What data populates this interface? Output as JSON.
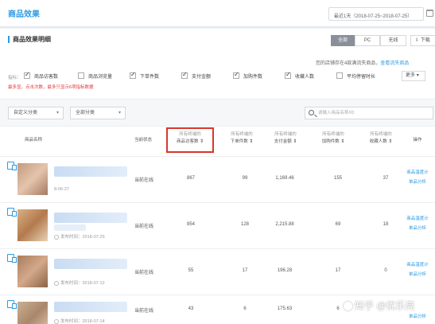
{
  "page": {
    "title": "商品效果"
  },
  "date_range": {
    "label": "最近1天（2018-07-25~2018-07-25）"
  },
  "section": {
    "title": "商品效果明细",
    "segments": [
      "全部",
      "PC",
      "无线"
    ],
    "active_segment": "全部",
    "download_label": "下载"
  },
  "limit_note": {
    "text": "您的店铺存在4款满流失商品，",
    "link": "查看流失商品"
  },
  "metrics": {
    "prefix": "指标：",
    "items": [
      {
        "label": "商品访客数",
        "checked": true
      },
      {
        "label": "商品浏览量",
        "checked": false
      },
      {
        "label": "下单件数",
        "checked": true
      },
      {
        "label": "支付金额",
        "checked": true
      },
      {
        "label": "加购件数",
        "checked": true
      },
      {
        "label": "收藏人数",
        "checked": true
      },
      {
        "label": "平均停留时长",
        "checked": false
      }
    ],
    "more_label": "更多",
    "warning": "最多显，点击次数，最多只显示6项指标数据"
  },
  "filters": {
    "category_1": "自定义分类",
    "category_2": "全部分类",
    "search_placeholder": "请输入商品名称/ID"
  },
  "table": {
    "columns": [
      {
        "sub": "",
        "label": "商品名称"
      },
      {
        "sub": "",
        "label": "当前状态"
      },
      {
        "sub": "所有终端的",
        "label": "商品访客数"
      },
      {
        "sub": "所有终端的",
        "label": "下单件数"
      },
      {
        "sub": "所有终端的",
        "label": "支付金额"
      },
      {
        "sub": "所有终端的",
        "label": "加购件数"
      },
      {
        "sub": "所有终端的",
        "label": "收藏人数"
      },
      {
        "sub": "",
        "label": "操作"
      }
    ],
    "rows": [
      {
        "publish": "8-06-27",
        "status": "当前在线",
        "visitors": "867",
        "orders": "99",
        "payment": "1,169.46",
        "cart": "155",
        "favorites": "37",
        "actions": [
          "商品温度计",
          "单品分析"
        ]
      },
      {
        "publish": "发布时间：2018-07-25",
        "status": "当前在线",
        "visitors": "854",
        "orders": "128",
        "payment": "2,215.88",
        "cart": "69",
        "favorites": "18",
        "actions": [
          "商品温度计",
          "单品分析"
        ]
      },
      {
        "publish": "发布时间：2018-07-12",
        "status": "当前在线",
        "visitors": "55",
        "orders": "17",
        "payment": "196.28",
        "cart": "17",
        "favorites": "0",
        "actions": [
          "商品温度计",
          "单品分析"
        ]
      },
      {
        "publish": "发布时间：2018-07-14",
        "status": "当前在线",
        "visitors": "43",
        "orders": "6",
        "payment": "175.63",
        "cart": "6",
        "favorites": "",
        "actions": [
          "商品温度计",
          "单品分析"
        ]
      }
    ]
  },
  "watermark": {
    "text": "知乎 @优乐亮"
  },
  "colors": {
    "accent": "#2e9be0",
    "highlight": "#d9362b",
    "warning": "#e4393c"
  }
}
